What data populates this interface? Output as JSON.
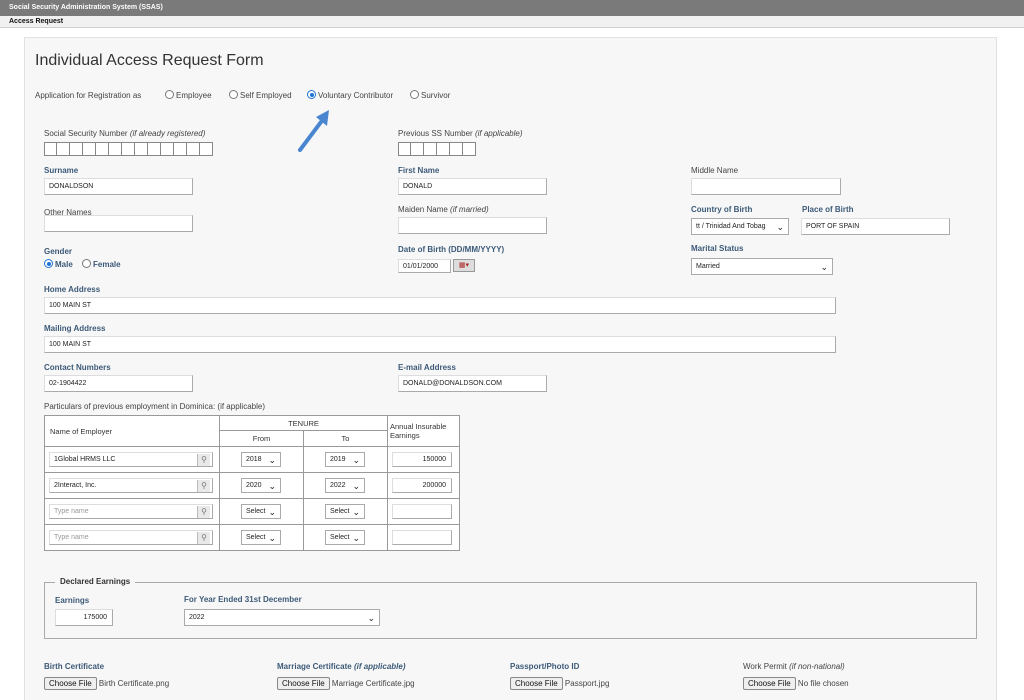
{
  "header": {
    "system_title": "Social Security Administration System (SSAS)",
    "subtitle": "Access Request"
  },
  "form": {
    "title": "Individual Access Request Form",
    "registration": {
      "label": "Application for Registration as",
      "options": [
        "Employee",
        "Self Employed",
        "Voluntary Contributor",
        "Survivor"
      ],
      "selected": "Voluntary Contributor"
    },
    "ssn": {
      "label": "Social Security Number",
      "hint": "(if already registered)",
      "boxes": 13
    },
    "prev_ssn": {
      "label": "Previous SS Number",
      "hint": "(if applicable)",
      "boxes": 6
    },
    "surname": {
      "label": "Surname",
      "value": "DONALDSON"
    },
    "first_name": {
      "label": "First Name",
      "value": "DONALD"
    },
    "middle_name": {
      "label": "Middle Name",
      "value": ""
    },
    "other_names": {
      "label": "Other Names",
      "value": ""
    },
    "maiden_name": {
      "label": "Maiden Name",
      "hint": "(if married)",
      "value": ""
    },
    "country_of_birth": {
      "label": "Country of Birth",
      "value": "tt / Trinidad And Tobag"
    },
    "place_of_birth": {
      "label": "Place of Birth",
      "value": "PORT OF SPAIN"
    },
    "gender": {
      "label": "Gender",
      "options": [
        "Male",
        "Female"
      ],
      "selected": "Male"
    },
    "dob": {
      "label": "Date of Birth (DD/MM/YYYY)",
      "value": "01/01/2000"
    },
    "marital_status": {
      "label": "Marital Status",
      "value": "Married"
    },
    "home_address": {
      "label": "Home Address",
      "value": "100 MAIN ST"
    },
    "mailing_address": {
      "label": "Mailing Address",
      "value": "100 MAIN ST"
    },
    "contact_numbers": {
      "label": "Contact Numbers",
      "value": "02-1904422"
    },
    "email": {
      "label": "E-mail Address",
      "value": "DONALD@DONALDSON.COM"
    },
    "employment": {
      "label": "Particulars of previous employment in Dominica: (if applicable)",
      "col_employer": "Name of Employer",
      "col_tenure": "TENURE",
      "col_from": "From",
      "col_to": "To",
      "col_earnings": "Annual Insurable Earnings",
      "rows": [
        {
          "employer": "1Global HRMS LLC",
          "from": "2018",
          "to": "2019",
          "earnings": "150000"
        },
        {
          "employer": "2Interact, Inc.",
          "from": "2020",
          "to": "2022",
          "earnings": "200000"
        },
        {
          "employer": "",
          "from": "Select",
          "to": "Select",
          "earnings": ""
        },
        {
          "employer": "",
          "from": "Select",
          "to": "Select",
          "earnings": ""
        }
      ],
      "employer_placeholder": "Type name"
    },
    "declared": {
      "legend": "Declared Earnings",
      "earnings_label": "Earnings",
      "earnings_value": "175000",
      "year_label": "For Year Ended 31st December",
      "year_value": "2022"
    },
    "documents": {
      "birth": {
        "label": "Birth Certificate",
        "file": "Birth Certificate.png"
      },
      "marriage": {
        "label": "Marriage Certificate",
        "hint": "(if applicable)",
        "file": "Marriage Certificate.jpg"
      },
      "passport": {
        "label": "Passport/Photo ID",
        "file": "Passport.jpg"
      },
      "work_permit": {
        "label": "Work Permit",
        "hint": "(if non-national)",
        "file": "No file chosen"
      },
      "button_label": "Choose File"
    }
  },
  "colors": {
    "accent": "#1e73d6",
    "label_blue": "#3c5a78",
    "topbar": "#7a7a7a",
    "arrow": "#4a86d0"
  }
}
